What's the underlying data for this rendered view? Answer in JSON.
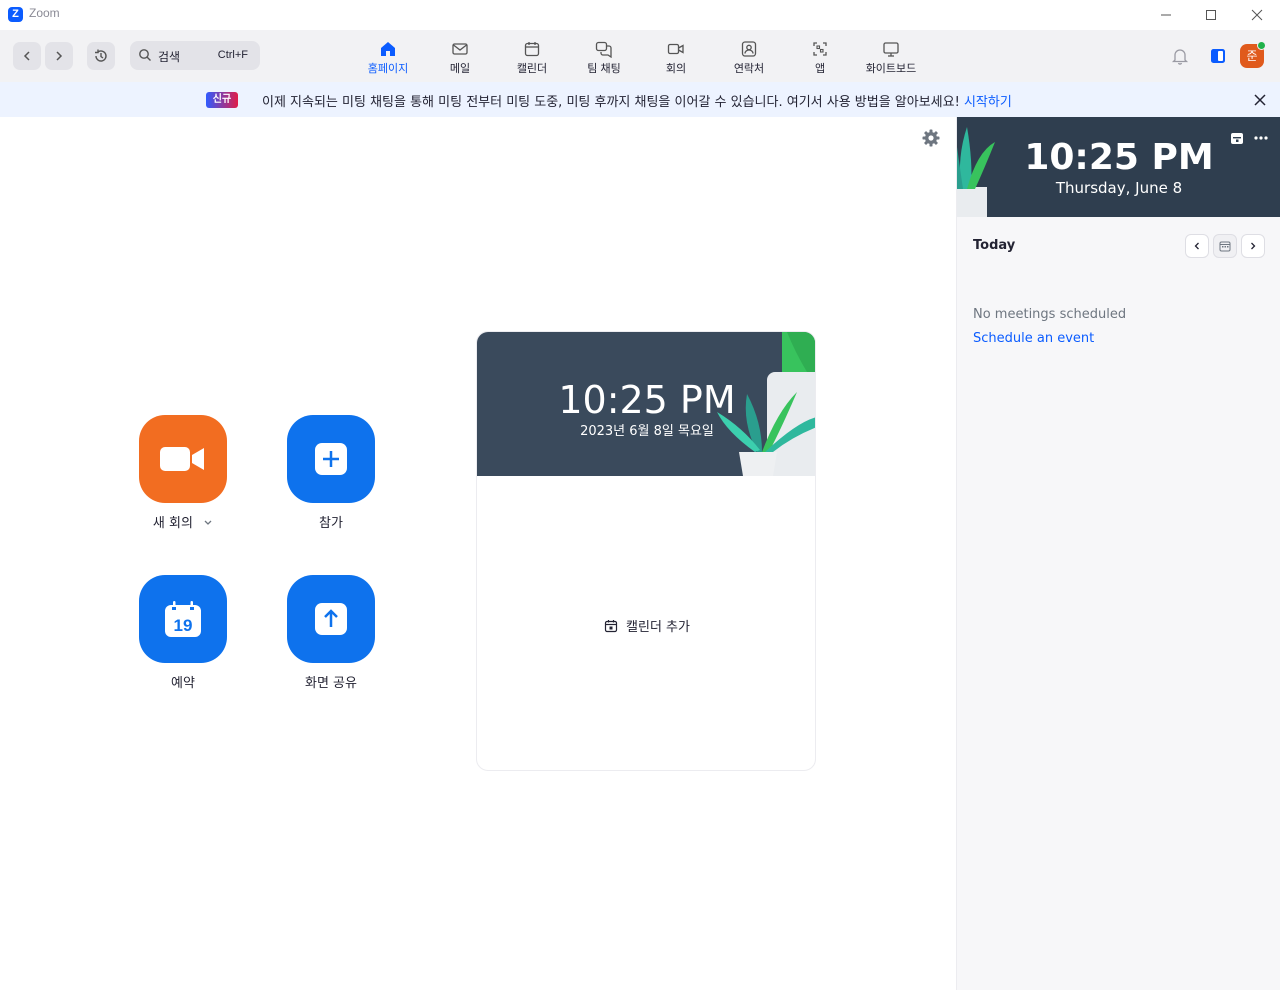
{
  "window": {
    "app_title": "Zoom",
    "logo_letter": "Z",
    "controls": [
      "minimize-icon",
      "maximize-icon",
      "close-icon"
    ]
  },
  "toolbar": {
    "search_label": "검색",
    "search_shortcut": "Ctrl+F",
    "tabs": [
      {
        "label": "홈페이지",
        "icon": "home-icon",
        "active": true
      },
      {
        "label": "메일",
        "icon": "mail-icon"
      },
      {
        "label": "캘린더",
        "icon": "calendar-icon"
      },
      {
        "label": "팀 채팅",
        "icon": "chat-icon"
      },
      {
        "label": "회의",
        "icon": "video-icon"
      },
      {
        "label": "연락처",
        "icon": "contacts-icon"
      },
      {
        "label": "앱",
        "icon": "apps-icon"
      },
      {
        "label": "화이트보드",
        "icon": "whiteboard-icon"
      }
    ],
    "avatar_initial": "준",
    "accent_color": "#0b5cff"
  },
  "banner": {
    "badge": "신규",
    "message": "이제 지속되는 미팅 채팅을 통해 미팅 전부터 미팅 도중, 미팅 후까지 채팅을 이어갈 수 있습니다. 여기서 사용 방법을 알아보세요!",
    "link": "시작하기"
  },
  "actions": [
    {
      "label": "새 회의",
      "icon": "video-camera-icon",
      "color": "#f26d21",
      "has_dropdown": true
    },
    {
      "label": "참가",
      "icon": "plus-icon",
      "color": "#0e72ed"
    },
    {
      "label": "예약",
      "icon": "calendar-19-icon",
      "color": "#0e72ed",
      "icon_text": "19"
    },
    {
      "label": "화면 공유",
      "icon": "share-arrow-icon",
      "color": "#0e72ed"
    }
  ],
  "center_card": {
    "time": "10:25 PM",
    "date": "2023년 6월 8일 목요일",
    "add_calendar": "캘린더 추가"
  },
  "right_panel": {
    "time": "10:25 PM",
    "date": "Thursday, June 8",
    "today_label": "Today",
    "empty_text": "No meetings scheduled",
    "schedule_link": "Schedule an event"
  }
}
